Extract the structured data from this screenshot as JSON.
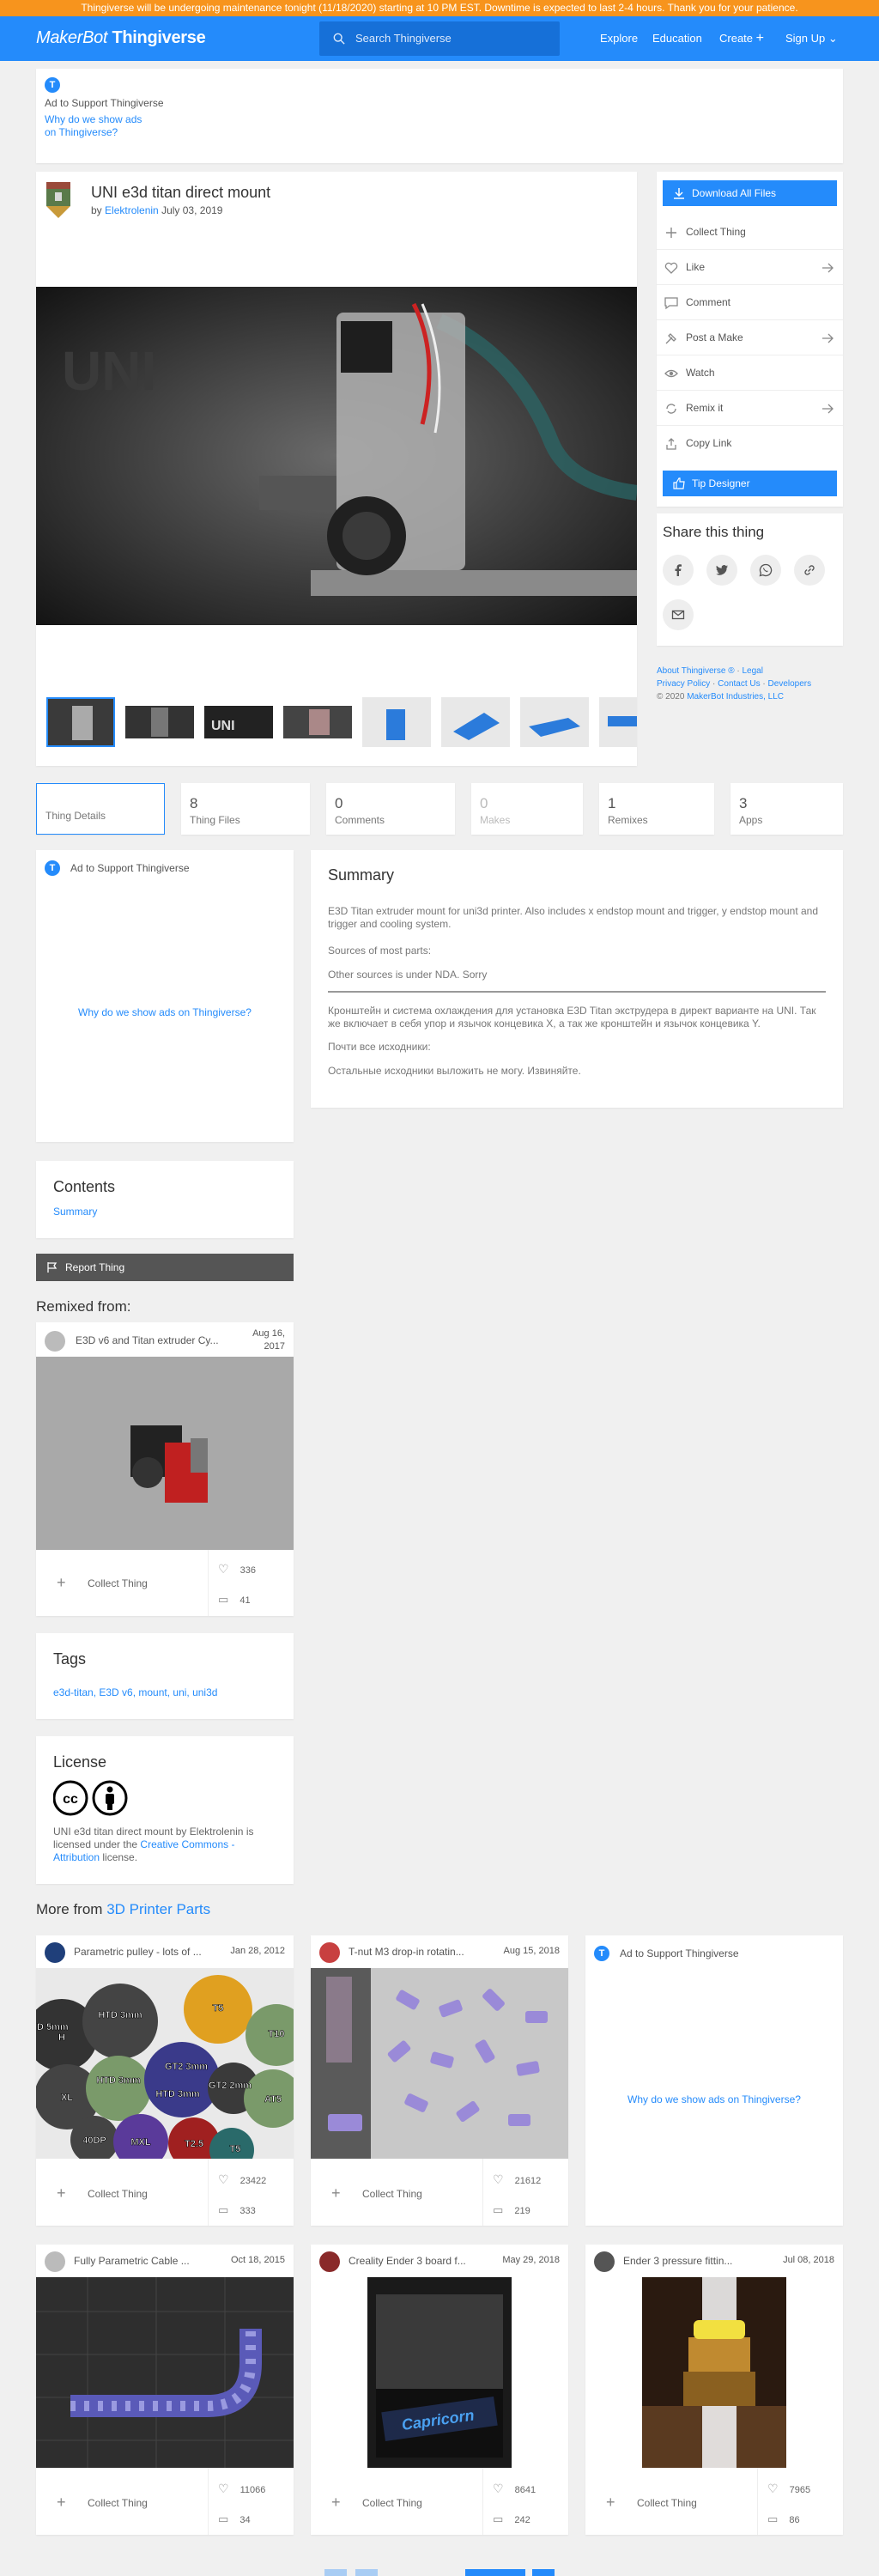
{
  "banner": {
    "text": "Thingiverse will be undergoing maintenance tonight (11/18/2020) starting at 10 PM EST. Downtime is expected to last 2-4 hours. Thank you for your patience."
  },
  "header": {
    "logo_brand": "MakerBot",
    "logo_product": "Thingiverse",
    "search_placeholder": "Search Thingiverse",
    "nav": {
      "explore": "Explore",
      "education": "Education",
      "create": "Create",
      "signup": "Sign Up"
    }
  },
  "top_ad": {
    "title": "Ad to Support Thingiverse",
    "link": "Why do we show ads on Thingiverse?"
  },
  "thing": {
    "title": "UNI e3d titan direct mount",
    "by": "by",
    "author": "Elektrolenin",
    "date": "July 03, 2019"
  },
  "actions": {
    "download": "Download All Files",
    "collect": "Collect Thing",
    "like": "Like",
    "comment": "Comment",
    "post_make": "Post a Make",
    "watch": "Watch",
    "remix": "Remix it",
    "copy_link": "Copy Link",
    "tip": "Tip Designer"
  },
  "share": {
    "title": "Share this thing"
  },
  "footer_links": {
    "about": "About Thingiverse ®",
    "sep": "·",
    "legal": "Legal",
    "privacy": "Privacy Policy",
    "contact": "Contact Us",
    "developers": "Developers",
    "copyright": "© 2020",
    "company": "MakerBot Industries, LLC"
  },
  "stats": [
    {
      "num": "",
      "label": "Thing Details"
    },
    {
      "num": "8",
      "label": "Thing Files"
    },
    {
      "num": "0",
      "label": "Comments"
    },
    {
      "num": "0",
      "label": "Makes"
    },
    {
      "num": "1",
      "label": "Remixes"
    },
    {
      "num": "3",
      "label": "Apps"
    }
  ],
  "side_ad": {
    "title": "Ad to Support Thingiverse",
    "link": "Why do we show ads on Thingiverse?"
  },
  "summary": {
    "title": "Summary",
    "p1": "E3D Titan extruder mount for uni3d printer. Also includes x endstop mount and trigger, y endstop mount and trigger and cooling system.",
    "p2": "Sources of most parts:",
    "p3": "Other sources is under NDA. Sorry",
    "p4": "Кронштейн и система охлаждения для установка E3D Titan экструдера в директ варианте на UNI. Так же включает в себя упор и язычок концевика X, а так же кронштейн и язычок концевика Y.",
    "p5": "Почти все исходники:",
    "p6": "Остальные исходники выложить не могу. Извиняйте."
  },
  "contents": {
    "title": "Contents",
    "item": "Summary"
  },
  "report": {
    "label": "Report Thing"
  },
  "remixed": {
    "title": "Remixed from:",
    "card": {
      "name": "E3D v6 and Titan extruder Cy...",
      "date_l1": "Aug 16,",
      "date_l2": "2017",
      "collect": "Collect Thing",
      "likes": "336",
      "comments": "41"
    }
  },
  "tags": {
    "title": "Tags",
    "list": "e3d-titan, E3D v6, mount, uni, uni3d"
  },
  "license": {
    "title": "License",
    "t1": "UNI e3d titan direct mount",
    "t2": "by",
    "t3": "Elektrolenin",
    "t4": "is licensed under the",
    "t5": "Creative Commons - Attribution",
    "t6": "license."
  },
  "more": {
    "prefix": "More from",
    "category": "3D Printer Parts",
    "cards": [
      {
        "name": "Parametric pulley - lots of ...",
        "date": "Jan 28, 2012",
        "collect": "Collect Thing",
        "likes": "23422",
        "comments": "333"
      },
      {
        "name": "T-nut M3 drop-in rotatin...",
        "date": "Aug 15, 2018",
        "collect": "Collect Thing",
        "likes": "21612",
        "comments": "219"
      },
      {
        "name": "Fully Parametric Cable ...",
        "date": "Oct 18, 2015",
        "collect": "Collect Thing",
        "likes": "11066",
        "comments": "34"
      },
      {
        "name": "Creality Ender 3 board f...",
        "date": "May 29, 2018",
        "collect": "Collect Thing",
        "likes": "8641",
        "comments": "242"
      },
      {
        "name": "Ender 3 pressure fittin...",
        "date": "Jul 08, 2018",
        "collect": "Collect Thing",
        "likes": "7965",
        "comments": "86"
      }
    ],
    "ad": {
      "title": "Ad to Support Thingiverse",
      "link": "Why do we show ads on Thingiverse?"
    }
  },
  "pulley_labels": [
    "T5",
    "HTD 3mm",
    "GT2 3mm",
    "GT2 2mm",
    "T10",
    "XL",
    "HTD 3mm",
    "HTD 3mm",
    "HTD 5mm",
    "AT5",
    "MXL",
    "T2.5",
    "T5",
    "40DP",
    "H"
  ],
  "brand_text": "Capricorn",
  "colors": {
    "accent": "#248bfb",
    "banner": "#f7941d",
    "report": "#555555"
  }
}
